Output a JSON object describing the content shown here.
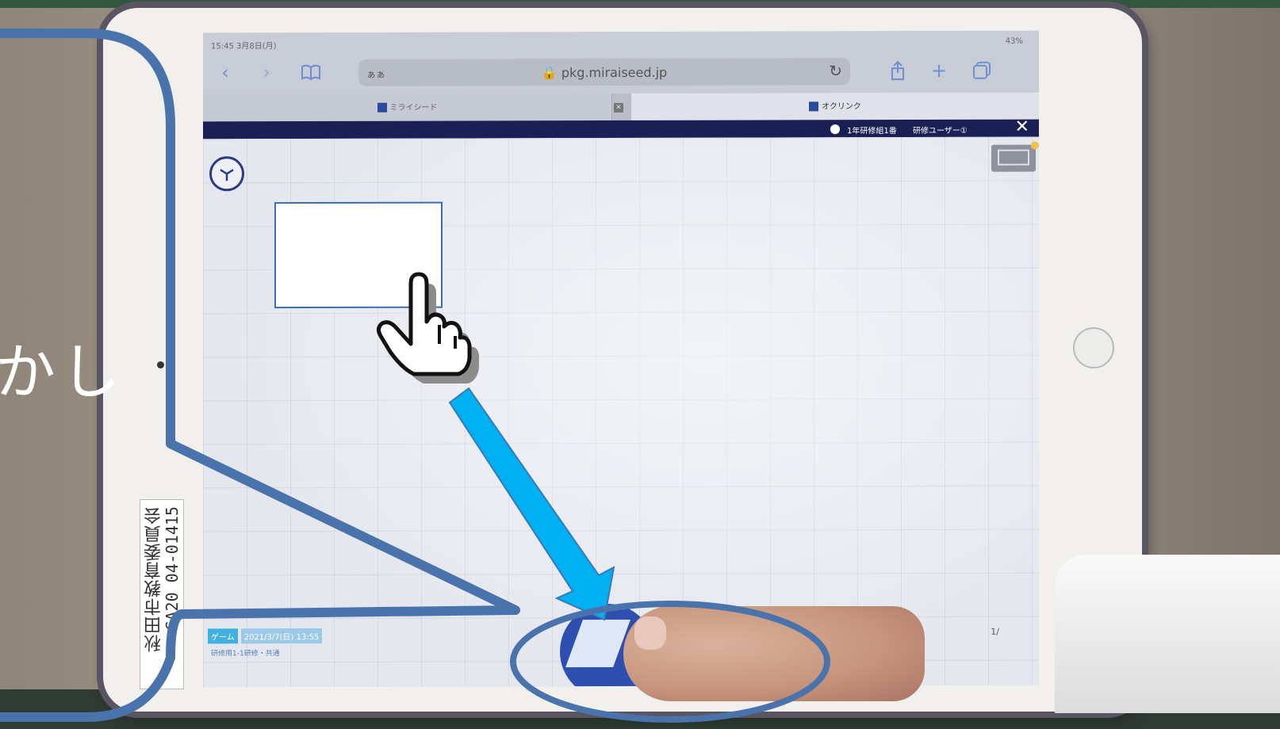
{
  "status": {
    "time": "15:45 3月8日(月)",
    "battery": "43%"
  },
  "browser": {
    "text_size_button": "ぁぁ",
    "url": "pkg.miraiseed.jp",
    "tabs": [
      {
        "label": "ミライシード"
      },
      {
        "label": "オクリンク"
      }
    ]
  },
  "app": {
    "class_name": "1年研修組1番",
    "user_name": "研修ユーザー①"
  },
  "canvas": {
    "footer_tag": "ゲーム",
    "footer_date": "2021/3/7(日) 13:55",
    "footer_sub": "研修用1-1研修・共通",
    "page_counter": "1/"
  },
  "device": {
    "asset_label_line1": "秋田市教育委員会",
    "asset_label_line2": "GA20 04-01415"
  },
  "overlay": {
    "caption_fragment": "かし"
  },
  "colors": {
    "callout_border": "#4a73ab",
    "arrow_fill": "#00b0f0",
    "app_bar": "#1a2054",
    "background": "#355740"
  },
  "icons": [
    "back-icon",
    "forward-icon",
    "bookmarks-icon",
    "lock-icon",
    "reload-icon",
    "share-icon",
    "new-tab-icon",
    "tabs-icon",
    "user-icon",
    "close-icon",
    "clock-icon",
    "present-icon",
    "hand-pointer-icon",
    "arrow-icon"
  ]
}
